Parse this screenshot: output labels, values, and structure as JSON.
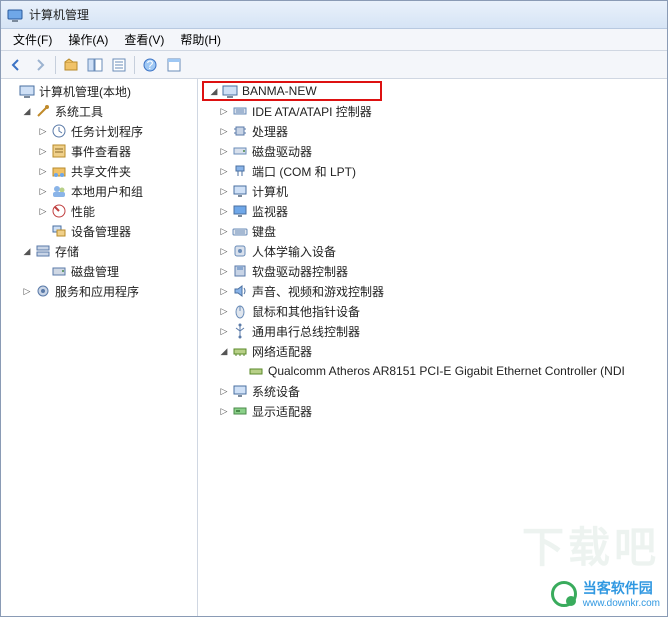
{
  "window": {
    "title": "计算机管理"
  },
  "menu": {
    "file": "文件(F)",
    "action": "操作(A)",
    "view": "查看(V)",
    "help": "帮助(H)"
  },
  "left_tree": {
    "root": "计算机管理(本地)",
    "system_tools": "系统工具",
    "task_scheduler": "任务计划程序",
    "event_viewer": "事件查看器",
    "shared_folders": "共享文件夹",
    "local_users": "本地用户和组",
    "performance": "性能",
    "device_manager": "设备管理器",
    "storage": "存储",
    "disk_management": "磁盘管理",
    "services_apps": "服务和应用程序"
  },
  "right_tree": {
    "root": "BANMA-NEW",
    "ide": "IDE ATA/ATAPI 控制器",
    "cpu": "处理器",
    "disk_drives": "磁盘驱动器",
    "ports": "端口 (COM 和 LPT)",
    "computer": "计算机",
    "monitors": "监视器",
    "keyboards": "键盘",
    "hid": "人体学输入设备",
    "floppy": "软盘驱动器控制器",
    "sound": "声音、视频和游戏控制器",
    "mouse": "鼠标和其他指针设备",
    "usb": "通用串行总线控制器",
    "network": "网络适配器",
    "nic0": "Qualcomm Atheros AR8151 PCI-E Gigabit Ethernet Controller (NDI",
    "system_devices": "系统设备",
    "display": "显示适配器"
  },
  "watermark": {
    "brand": "当客软件园",
    "url": "www.downkr.com",
    "shadow": "下载吧"
  }
}
